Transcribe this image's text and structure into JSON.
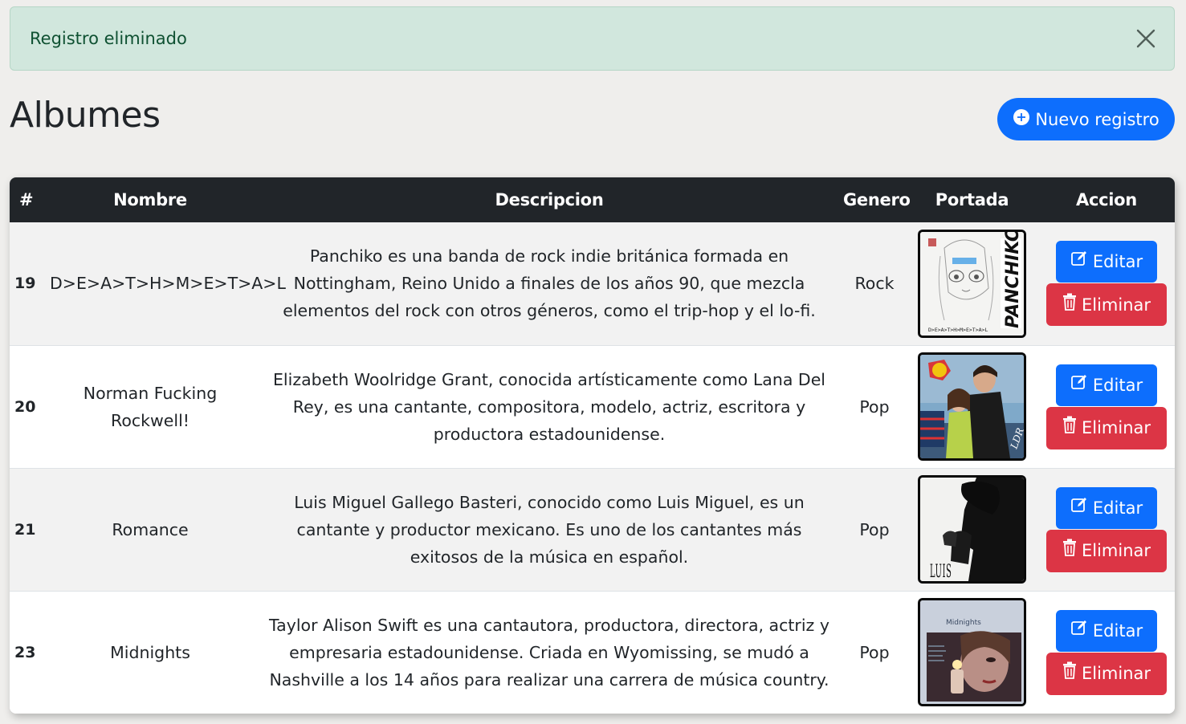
{
  "alert": {
    "message": "Registro eliminado",
    "icon": "close-icon"
  },
  "page": {
    "title": "Albumes"
  },
  "new_button": {
    "label": "Nuevo registro",
    "icon": "plus-circle-icon"
  },
  "table": {
    "headers": [
      "#",
      "Nombre",
      "Descripcion",
      "Genero",
      "Portada",
      "Accion"
    ],
    "rows": [
      {
        "id": "19",
        "name": "D>E>A>T>H>M>E>T>A>L",
        "description": "Panchiko es una banda de rock indie británica formada en Nottingham, Reino Unido a finales de los años 90, que mezcla elementos del rock con otros géneros, como el trip-hop y el lo-fi.",
        "genre": "Rock",
        "cover_text": "PANCHIKO",
        "cover_subtext": "D>E>A>T>H>M>E>T>A>L"
      },
      {
        "id": "20",
        "name": "Norman Fucking Rockwell!",
        "description": "Elizabeth Woolridge Grant, conocida artísticamente como Lana Del Rey, es una cantante, compositora, modelo, actriz, escritora y productora estadounidense.",
        "genre": "Pop",
        "cover_text": "LDR"
      },
      {
        "id": "21",
        "name": "Romance",
        "description": "Luis Miguel Gallego Basteri,  conocido como Luis Miguel, es un cantante y productor mexicano. Es uno de los cantantes más exitosos de la música en español.",
        "genre": "Pop",
        "cover_text": "LUIS"
      },
      {
        "id": "23",
        "name": "Midnights",
        "description": "Taylor Alison Swift es una cantautora, productora, directora, actriz y empresaria estadounidense. Criada en Wyomissing, se mudó a Nashville a los 14 años para realizar una carrera de música country.",
        "genre": "Pop",
        "cover_text": "Midnights"
      }
    ],
    "edit_label": "Editar",
    "delete_label": "Eliminar",
    "edit_icon": "pencil-square-icon",
    "delete_icon": "trash-icon"
  },
  "colors": {
    "primary": "#0d6efd",
    "danger": "#dc3545",
    "alert_bg": "#d1e7dd",
    "alert_text": "#0f5132",
    "table_header": "#212529"
  }
}
